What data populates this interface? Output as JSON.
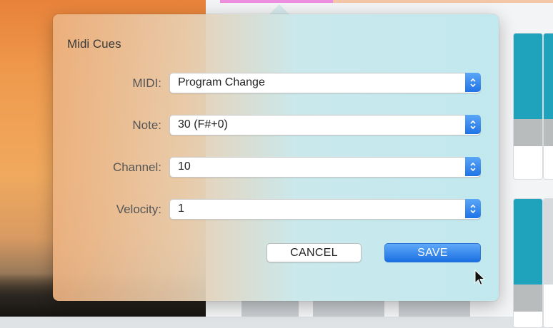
{
  "dialog": {
    "title": "Midi Cues",
    "fields": [
      {
        "label": "MIDI:",
        "value": "Program Change"
      },
      {
        "label": "Note:",
        "value": "30 (F#+0)"
      },
      {
        "label": "Channel:",
        "value": "10"
      },
      {
        "label": "Velocity:",
        "value": "1"
      }
    ],
    "cancel_label": "CANCEL",
    "save_label": "SAVE"
  },
  "icons": {
    "stepper": "chevron-up-down-icon",
    "cursor": "mouse-pointer-icon"
  },
  "colors": {
    "accent": "#1f74e6",
    "card_teal": "#1fa3bc"
  }
}
